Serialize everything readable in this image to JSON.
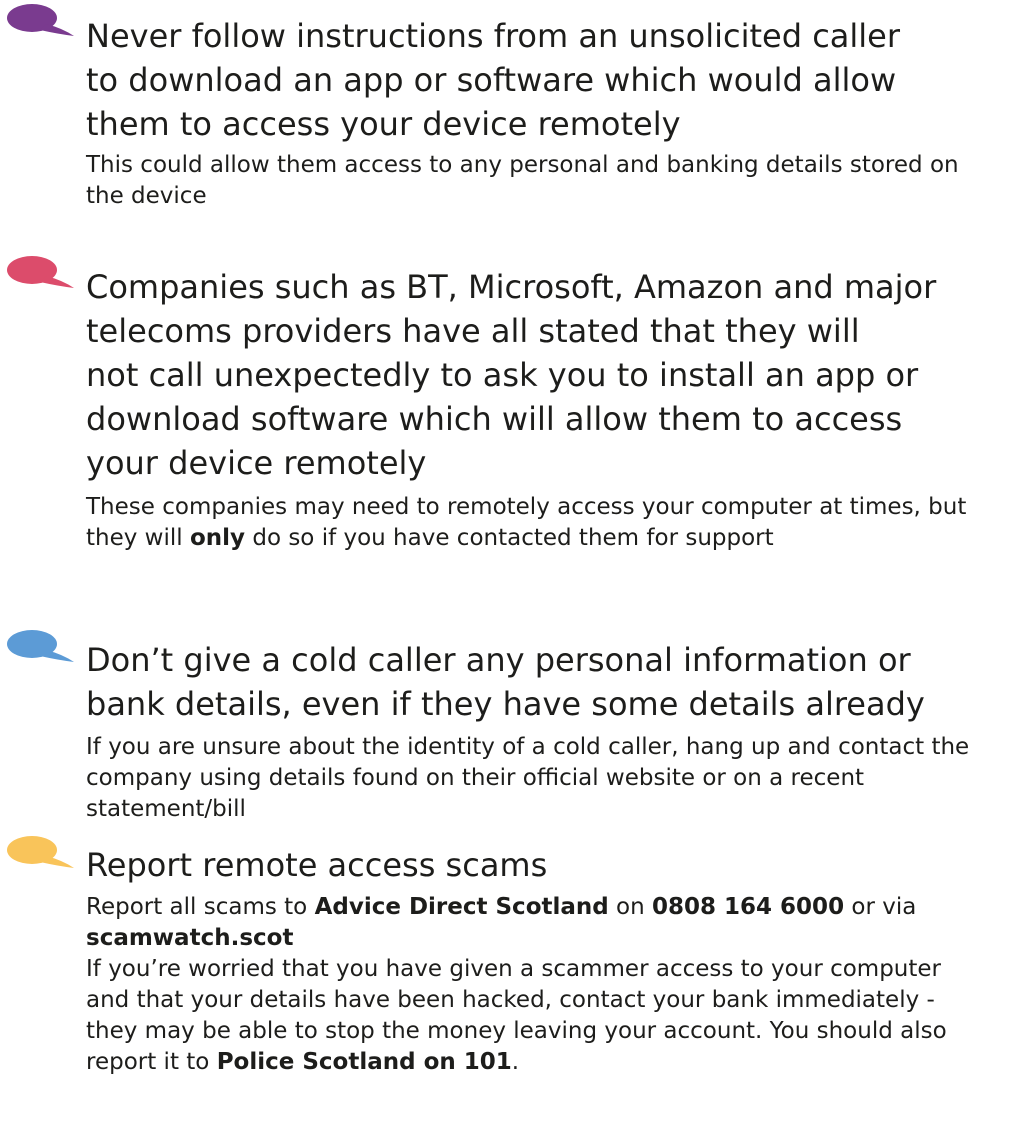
{
  "colors": {
    "bubble_purple": "#7a3b8f",
    "bubble_pink": "#dc4c6b",
    "bubble_blue": "#5c9bd6",
    "bubble_yellow": "#f9c45a"
  },
  "sections": [
    {
      "icon": "speech-bubble-icon",
      "heading": "Never follow instructions from an unsolicited caller\nto download an app or software which would allow\nthem to access your device remotely",
      "body": "This could allow them access to any personal and banking details stored on the device"
    },
    {
      "icon": "speech-bubble-icon",
      "heading": "Companies such as BT, Microsoft, Amazon and major\ntelecoms providers have all stated that they will\nnot call unexpectedly to ask you to install an app or\ndownload software which will allow them to access\nyour device remotely",
      "body_part1": "These companies may need to remotely access your computer at times, but they will ",
      "body_strong": "only",
      "body_part2": " do so if you have contacted them for support"
    },
    {
      "icon": "speech-bubble-icon",
      "heading": "Don’t give a cold caller any personal information or\nbank details, even if they have some details already",
      "body": "If you are unsure about the identity of a cold caller, hang up and contact the company using details found on their official website or on a recent statement/bill"
    },
    {
      "icon": "speech-bubble-icon",
      "heading": "Report remote access scams",
      "p1_part1": "Report all scams to ",
      "p1_org": "Advice Direct Scotland",
      "p1_part2": " on ",
      "p1_phone": "0808 164 6000",
      "p1_part3": " or via ",
      "p1_site": "scamwatch.scot",
      "p2_part1": "If you’re worried that you have given a scammer access to your computer and that your details have been hacked, contact your bank immediately - they may be able to stop the money leaving your account. You should also report it to ",
      "p2_police": "Police Scotland on 101",
      "p2_part2": "."
    }
  ]
}
